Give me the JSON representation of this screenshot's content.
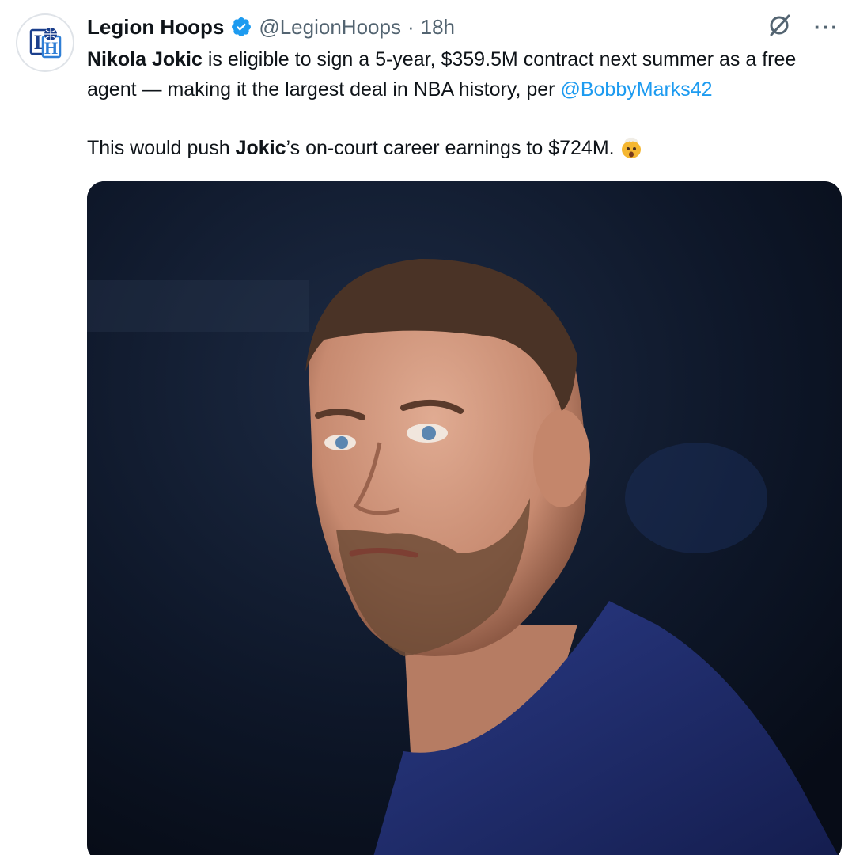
{
  "author": {
    "display_name": "Legion Hoops",
    "handle": "@LegionHoops",
    "separator": "·",
    "time": "18h",
    "verified": true,
    "avatar_icon": "legion-hoops-logo-icon"
  },
  "actions": {
    "grok_icon": "grok-icon",
    "more_icon": "more-icon",
    "more_label": "···"
  },
  "tweet": {
    "p1_name": "Nikola Jokic",
    "p1_text": " is eligible to sign a 5-year, $359.5M contract next summer as a free agent — making it the largest deal in NBA history, per ",
    "p1_mention": "@BobbyMarks42",
    "p2_pre": "This would push ",
    "p2_name": "Jokic",
    "p2_post": "’s on-court career earnings to $724M.",
    "p2_emoji": "exploding-head-emoji"
  },
  "media": {
    "type": "photo",
    "subject_icon": "player-photo"
  },
  "colors": {
    "link": "#1d9bf0",
    "verified": "#1d9bf0",
    "secondary_text": "#536471",
    "jersey": "#1c2a6b"
  }
}
